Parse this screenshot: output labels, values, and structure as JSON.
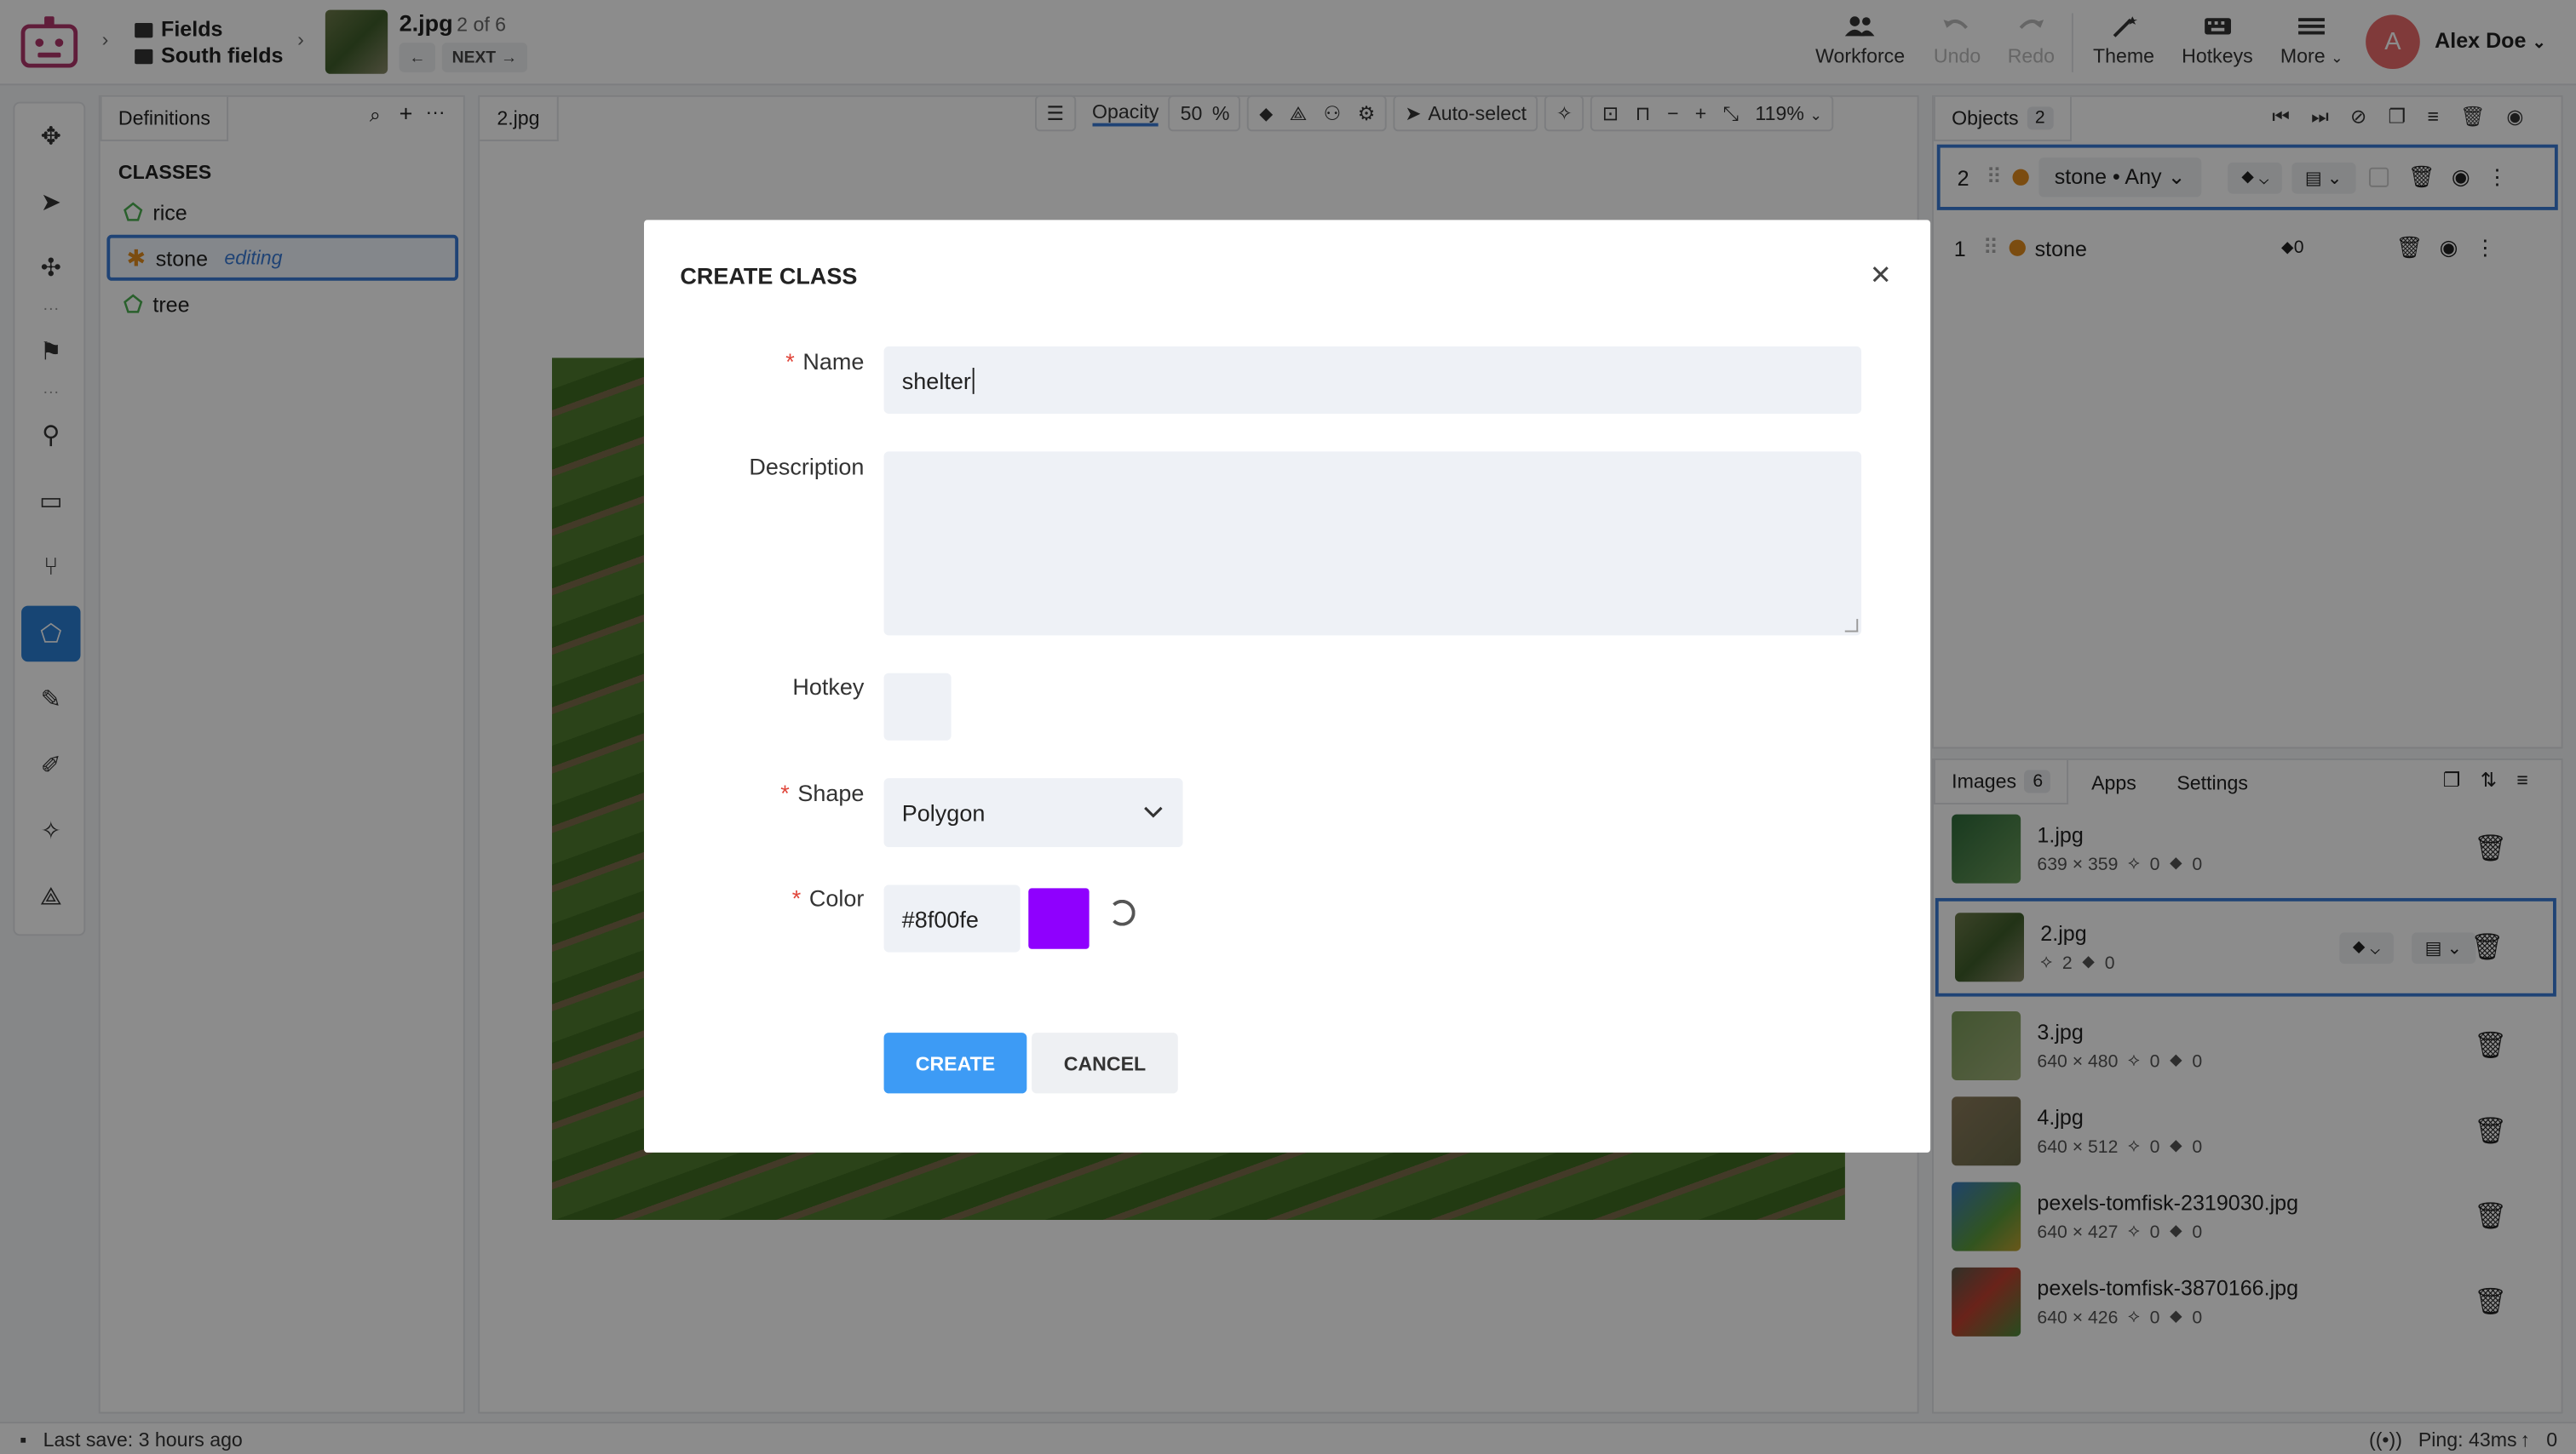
{
  "colors": {
    "accent": "#3a7bd5",
    "primary_button": "#3d9bf5",
    "class_color": "#8f00fe",
    "object_dot": "#e08a1e",
    "avatar": "#e96b6b",
    "required_star": "#e0453a"
  },
  "breadcrumb": {
    "project": "Fields",
    "dataset": "South fields",
    "image_name": "2.jpg",
    "image_position": "2 of 6",
    "next_label": "NEXT"
  },
  "toolbar": {
    "workforce": "Workforce",
    "undo": "Undo",
    "redo": "Redo",
    "theme": "Theme",
    "hotkeys": "Hotkeys",
    "more": "More"
  },
  "user": {
    "initial": "A",
    "name": "Alex Doe"
  },
  "definitions": {
    "tab": "Definitions",
    "heading": "CLASSES",
    "classes": [
      {
        "name": "rice",
        "tag": ""
      },
      {
        "name": "stone",
        "tag": "editing"
      },
      {
        "name": "tree",
        "tag": ""
      }
    ]
  },
  "canvas": {
    "tab": "2.jpg",
    "opacity_label": "Opacity",
    "opacity_value": "50",
    "opacity_unit": "%",
    "auto_select": "Auto-select",
    "zoom": "119%"
  },
  "objects": {
    "tab": "Objects",
    "count": "2",
    "items": [
      {
        "index": "2",
        "label": "stone • Any"
      },
      {
        "index": "1",
        "label": "stone",
        "tag_count": "0"
      }
    ]
  },
  "images": {
    "tabs": [
      "Images",
      "Apps",
      "Settings"
    ],
    "count": "6",
    "items": [
      {
        "name": "1.jpg",
        "size": "639 × 359",
        "objects": "0",
        "tags": "0"
      },
      {
        "name": "2.jpg",
        "size": "",
        "objects": "2",
        "tags": "0"
      },
      {
        "name": "3.jpg",
        "size": "640 × 480",
        "objects": "0",
        "tags": "0"
      },
      {
        "name": "4.jpg",
        "size": "640 × 512",
        "objects": "0",
        "tags": "0"
      },
      {
        "name": "pexels-tomfisk-2319030.jpg",
        "size": "640 × 427",
        "objects": "0",
        "tags": "0"
      },
      {
        "name": "pexels-tomfisk-3870166.jpg",
        "size": "640 × 426",
        "objects": "0",
        "tags": "0"
      }
    ]
  },
  "status": {
    "last_save": "Last save: 3 hours ago",
    "ping": "Ping: 43ms",
    "upload_count": "0"
  },
  "modal": {
    "title": "CREATE CLASS",
    "name_label": "Name",
    "name_value": "shelter",
    "description_label": "Description",
    "description_value": "",
    "hotkey_label": "Hotkey",
    "hotkey_value": "",
    "shape_label": "Shape",
    "shape_value": "Polygon",
    "color_label": "Color",
    "color_value": "#8f00fe",
    "create_label": "CREATE",
    "cancel_label": "CANCEL"
  }
}
